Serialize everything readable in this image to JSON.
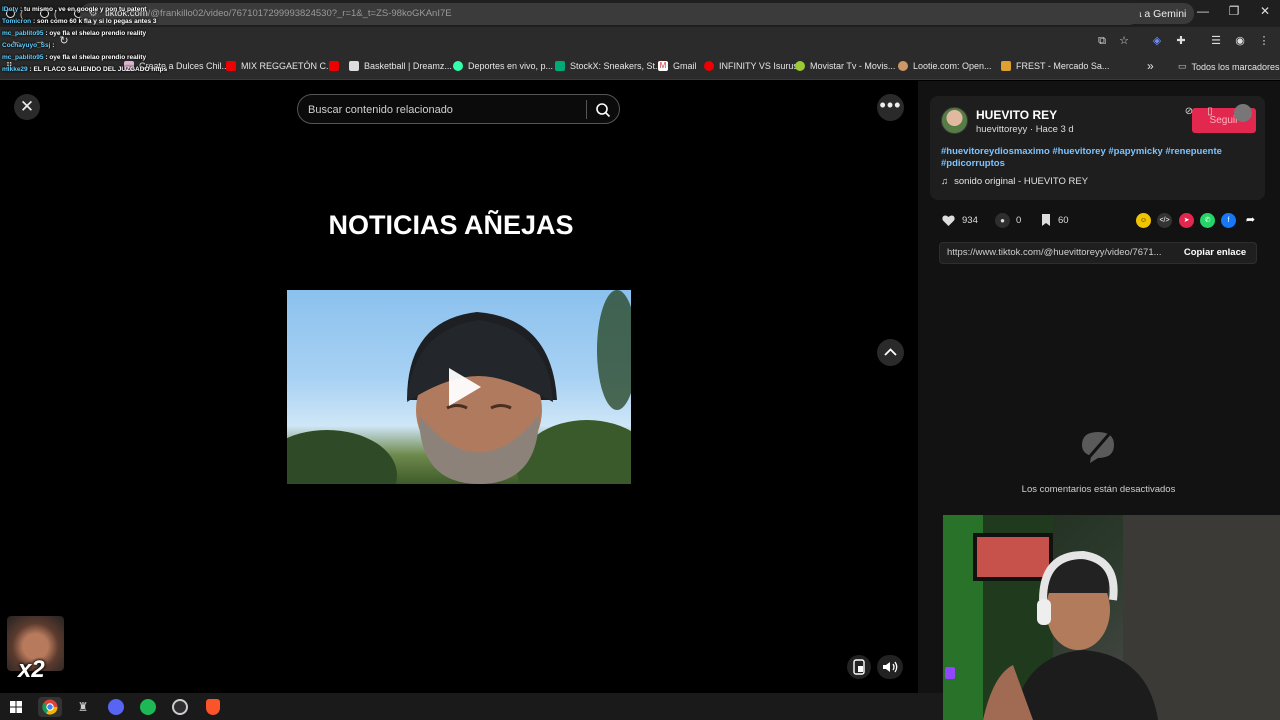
{
  "browser": {
    "url_domain": "tiktok.com",
    "url_path": "/@frankillo02/video/7671017299993824530?_r=1&_t=ZS-98koGKAnI7E",
    "gemini_label": "Pregunta a Gemini",
    "tabs": [
      {
        "icon": "tiktok-icon"
      },
      {
        "icon": "tiktok-icon"
      },
      {
        "icon": "tiktok-icon"
      },
      {
        "icon": "tiktok-icon"
      },
      {
        "icon": "tiktok-icon"
      },
      {
        "icon": "tiktok-icon"
      },
      {
        "icon": "tiktok-icon"
      },
      {
        "icon": "instagram-icon"
      },
      {
        "icon": "youtube-icon"
      },
      {
        "icon": "instagram-icon"
      },
      {
        "icon": "tiktok-icon"
      },
      {
        "icon": "tiktok-icon"
      },
      {
        "icon": "instagram-icon"
      },
      {
        "icon": "tiktok-icon"
      },
      {
        "icon": "instagram-icon"
      },
      {
        "icon": "messenger-icon"
      },
      {
        "icon": "tiktok-icon"
      },
      {
        "icon": "tiktok-icon"
      },
      {
        "icon": "instagram-icon"
      },
      {
        "icon": "tiktok-icon"
      },
      {
        "icon": "instagram-icon"
      },
      {
        "icon": "tiktok-icon"
      },
      {
        "icon": "x-icon"
      },
      {
        "icon": "tiktok-icon"
      },
      {
        "icon": "tiktok-icon"
      },
      {
        "icon": "tiktok-icon"
      },
      {
        "icon": "pen-icon"
      },
      {
        "icon": "twitch-icon"
      },
      {
        "icon": "tiktok-icon"
      }
    ]
  },
  "bookmarks": {
    "items": [
      {
        "label": "Create a Dulces Chil..."
      },
      {
        "label": "MIX REGGAETÓN C..."
      },
      {
        "label": "Basketball | Dreamz..."
      },
      {
        "label": "Deportes en vivo, p..."
      },
      {
        "label": "StockX: Sneakers, St..."
      },
      {
        "label": "Gmail"
      },
      {
        "label": "INFINITY VS Isurus"
      },
      {
        "label": "Movistar Tv - Movis..."
      },
      {
        "label": "Lootie.com: Open..."
      },
      {
        "label": "FREST - Mercado Sa..."
      }
    ],
    "more": "»",
    "all_label": "Todos los marcadores"
  },
  "chat": [
    {
      "user": "lDoty",
      "msg": "tu mismo , ve en google y pon tu patent"
    },
    {
      "user": "Tomicron",
      "msg": "son como 60 k fla y si lo pegas antes 3"
    },
    {
      "user": "mc_pablito95",
      "msg": "oye fla el shelao prendio reality"
    },
    {
      "user": "Cochayuyo_Ssj",
      "msg": ""
    },
    {
      "user": "mc_pablito95",
      "msg": "oye fla el shelao prendio reality"
    },
    {
      "user": "mikke29",
      "msg": "EL FLACO SALIENDO DEL JUZGADO https"
    }
  ],
  "video": {
    "search_placeholder": "Buscar contenido relacionado",
    "headline": "NOTICIAS AÑEJAS"
  },
  "panel": {
    "username": "HUEVITO REY",
    "handle": "huevittoreyy",
    "time_ago": "Hace 3 d",
    "follow_label": "Seguir",
    "hashtags": "#huevitoreydiosmaximo #huevitorey #papymicky #renepuente #pdicorruptos",
    "sound": "sonido original - HUEVITO REY",
    "likes": "934",
    "comments": "0",
    "saves": "60",
    "link": "https://www.tiktok.com/@huevittoreyy/video/7671...",
    "copy_label": "Copiar enlace",
    "comments_disabled": "Los comentarios están desactivados"
  },
  "sticker": {
    "multiplier": "x2"
  },
  "colors": {
    "accent": "#e2284f",
    "hashtag": "#7ec3ff",
    "panel_bg": "#121212"
  }
}
